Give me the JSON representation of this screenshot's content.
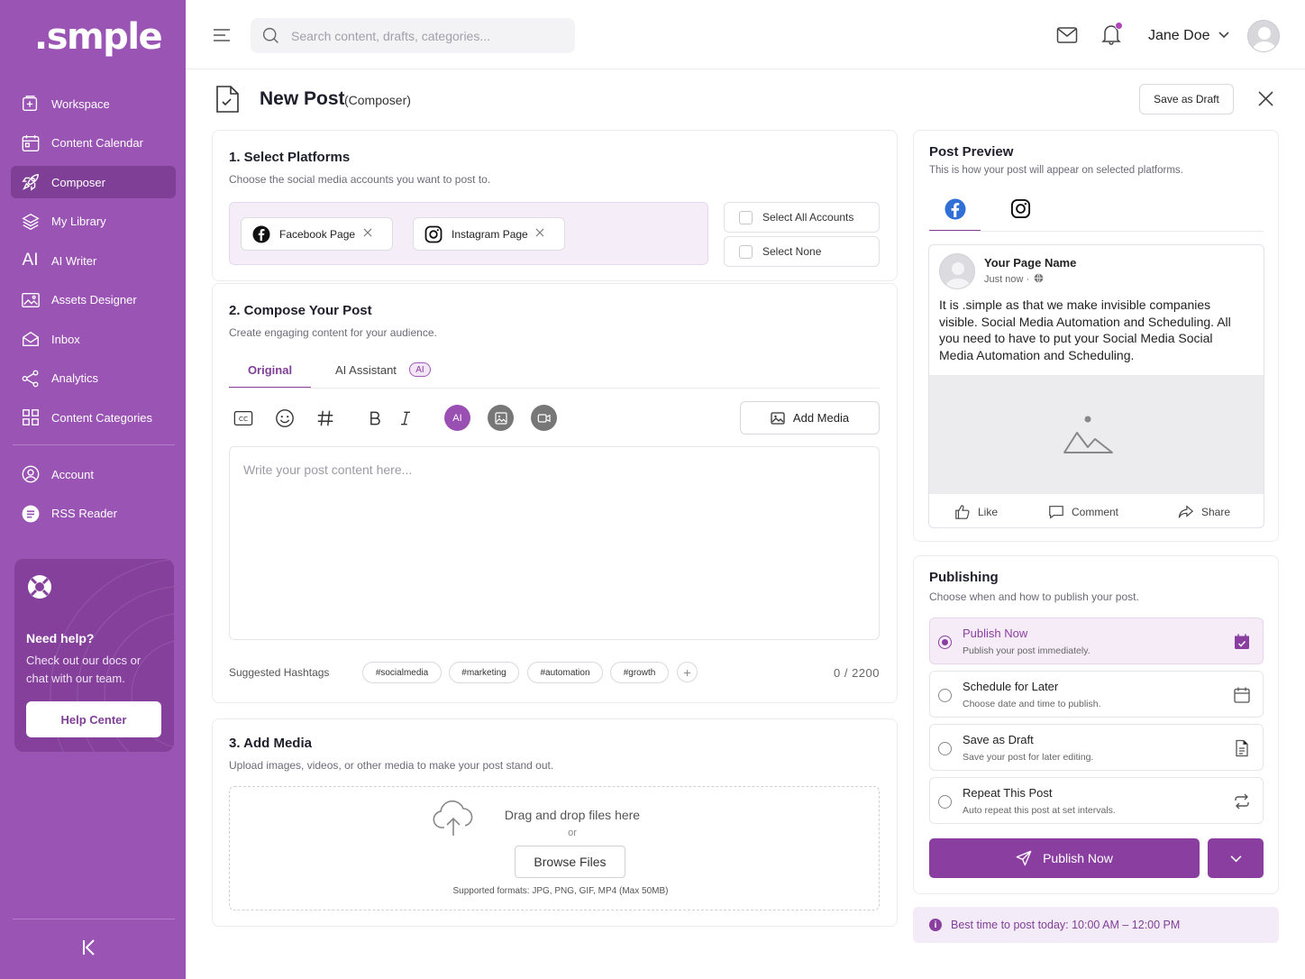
{
  "brand": {
    "logo": ".smple",
    "accent": "#8a3fa0",
    "sidebar_bg": "#9a54b3"
  },
  "sidebar": {
    "items": [
      {
        "label": "Workspace",
        "icon": "plus-square-icon"
      },
      {
        "label": "Content Calendar",
        "icon": "calendar-icon"
      },
      {
        "label": "Composer",
        "icon": "rocket-icon",
        "active": true
      },
      {
        "label": "My Library",
        "icon": "layers-icon"
      },
      {
        "label": "AI Writer",
        "icon": "ai-icon"
      },
      {
        "label": "Assets Designer",
        "icon": "image-gallery-icon"
      },
      {
        "label": "Inbox",
        "icon": "inbox-icon"
      },
      {
        "label": "Analytics",
        "icon": "share-nodes-icon"
      },
      {
        "label": "Content Categories",
        "icon": "grid-icon"
      }
    ],
    "secondary": [
      {
        "label": "Account",
        "icon": "user-circle-icon"
      },
      {
        "label": "RSS Reader",
        "icon": "rss-icon"
      }
    ],
    "help": {
      "title": "Need help?",
      "text": "Check out our docs or chat with our team.",
      "button": "Help Center"
    }
  },
  "header": {
    "search_placeholder": "Search content, drafts, categories...",
    "user_name": "Jane Doe"
  },
  "page": {
    "title": "New Post",
    "subtitle": "(Composer)",
    "save_draft": "Save as Draft"
  },
  "platforms": {
    "title": "1.  Select Platforms",
    "subtitle": "Choose the social media accounts you want to post to.",
    "chips": [
      "Facebook Page",
      "Instagram Page"
    ],
    "select_all": "Select All Accounts",
    "select_none": "Select None"
  },
  "compose": {
    "title": "2.  Compose Your Post",
    "subtitle": "Create engaging content for your audience.",
    "tab_original": "Original",
    "tab_ai": "AI Assistant",
    "ai_badge": "AI",
    "toolbar_ai": "AI",
    "add_media": "Add Media",
    "placeholder": "Write your post content here...",
    "suggested_label": "Suggested Hashtags",
    "hashtags": [
      "#socialmedia",
      "#marketing",
      "#automation",
      "#growth"
    ],
    "counter": "0 / 2200"
  },
  "media": {
    "title": "3.  Add Media",
    "subtitle": "Upload images, videos, or other media to make your post stand out.",
    "drop_text": "Drag and drop files here",
    "or": "or",
    "browse": "Browse Files",
    "formats": "Supported formats: JPG, PNG, GIF, MP4 (Max 50MB)"
  },
  "preview": {
    "title": "Post Preview",
    "subtitle": "This is how your post will appear on selected platforms.",
    "page_name": "Your Page Name",
    "time": "Just now ·",
    "text": "It is .simple as that we make invisible companies visible. Social Media Automation and Scheduling. All you need to have to put your Social Media Social Media Automation and Scheduling.",
    "like": "Like",
    "comment": "Comment",
    "share": "Share"
  },
  "publishing": {
    "title": "Publishing",
    "subtitle": "Choose when and how to publish your post.",
    "options": [
      {
        "title": "Publish Now",
        "desc": "Publish your post immediately.",
        "icon": "calendar-check-icon",
        "selected": true
      },
      {
        "title": "Schedule for Later",
        "desc": "Choose date and time to publish.",
        "icon": "calendar-icon"
      },
      {
        "title": "Save as Draft",
        "desc": "Save your post for later editing.",
        "icon": "document-icon"
      },
      {
        "title": "Repeat This Post",
        "desc": "Auto repeat this post at set intervals.",
        "icon": "repeat-icon"
      }
    ],
    "button": "Publish Now",
    "best_time": "Best time to post today: 10:00 AM – 12:00 PM"
  }
}
